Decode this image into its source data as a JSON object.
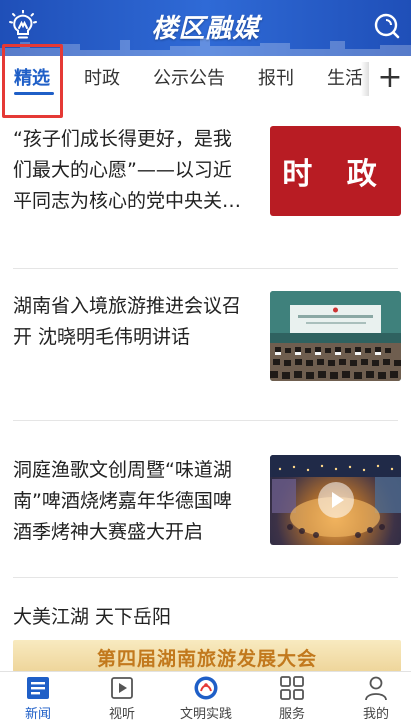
{
  "header": {
    "brand": "楼区融媒",
    "accent_color": "#1f5fc7",
    "left_icon": "lightbulb-icon",
    "right_icon": "search-icon"
  },
  "tabs": [
    {
      "label": "精选",
      "active": true
    },
    {
      "label": "时政",
      "active": false
    },
    {
      "label": "公示公告",
      "active": false
    },
    {
      "label": "报刊",
      "active": false
    },
    {
      "label": "生活",
      "active": false
    }
  ],
  "tab_add_label": "+",
  "news": [
    {
      "title_lines": [
        "“孩子们成长得更好，是我",
        "们最大的心愿”——以习近",
        "平同志为核心的党中央关…"
      ],
      "thumb_text": "时 政"
    },
    {
      "title_lines": [
        "湖南省入境旅游推进会议召",
        "开 沈晓明毛伟明讲话"
      ]
    },
    {
      "title_lines": [
        "洞庭渔歌文创周暨“味道湖",
        "南”啤酒烧烤嘉年华德国啤",
        "酒季烤神大赛盛大开启"
      ]
    },
    {
      "title_lines": [
        "大美江湖 天下岳阳"
      ],
      "banner_text": "第四届湖南旅游发展大会"
    }
  ],
  "bottom_nav": [
    {
      "label": "新闻",
      "icon": "news-icon",
      "active": true
    },
    {
      "label": "视听",
      "icon": "video-icon",
      "active": false
    },
    {
      "label": "文明实践",
      "icon": "civilization-icon",
      "active": false
    },
    {
      "label": "服务",
      "icon": "grid-icon",
      "active": false
    },
    {
      "label": "我的",
      "icon": "user-icon",
      "active": false
    }
  ]
}
